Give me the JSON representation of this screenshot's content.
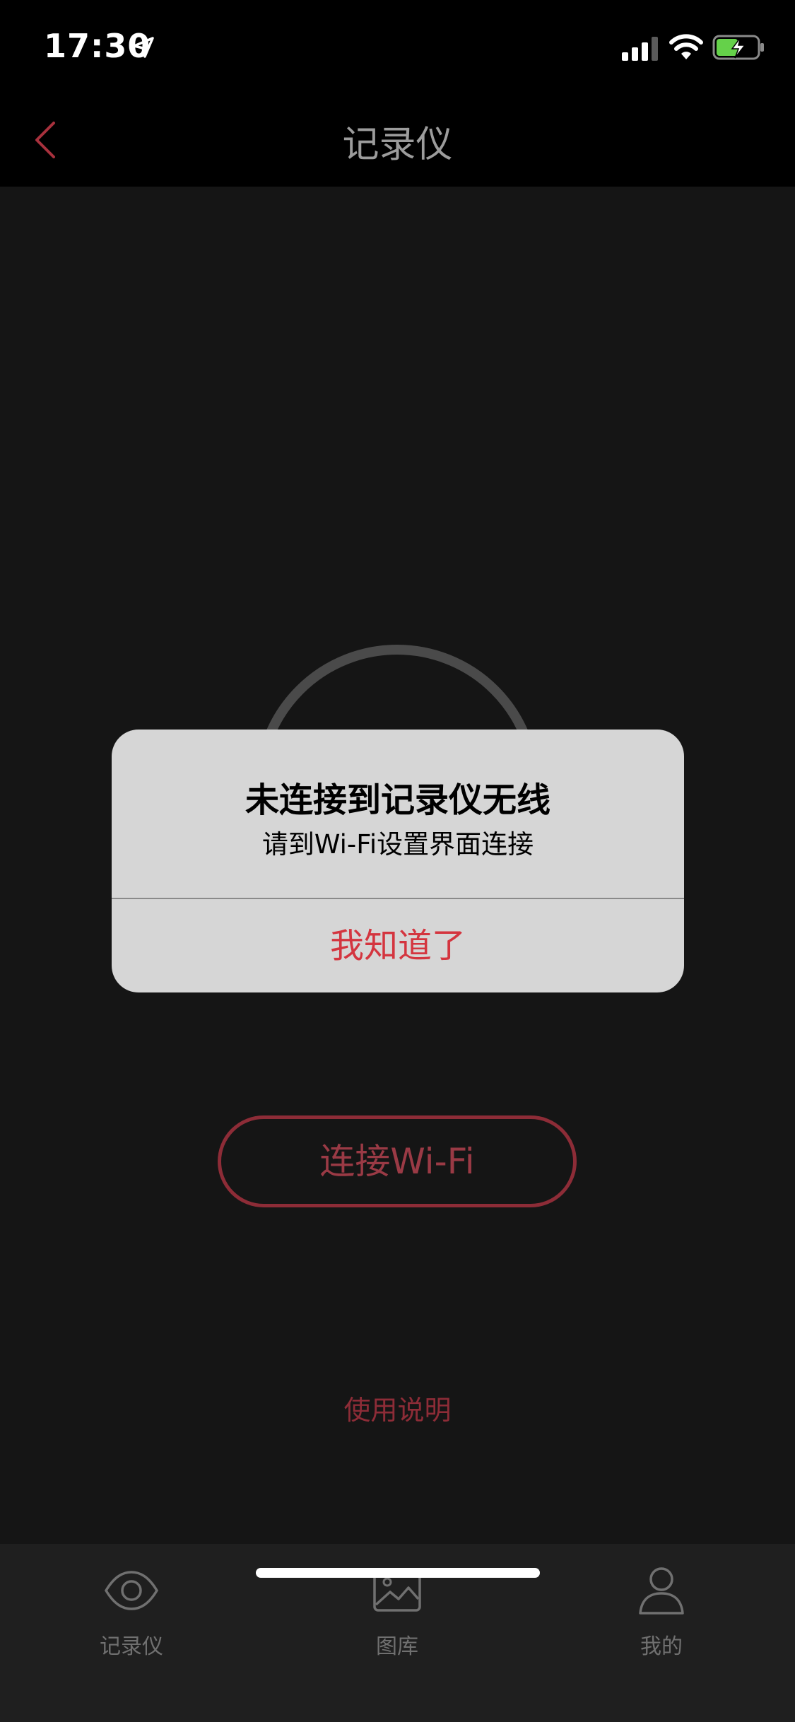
{
  "status_bar": {
    "time": "17:30"
  },
  "navbar": {
    "title": "记录仪"
  },
  "main": {
    "connect_button_label": "连接Wi-Fi",
    "manual_link_label": "使用说明"
  },
  "alert": {
    "title": "未连接到记录仪无线",
    "message": "请到Wi-Fi设置界面连接",
    "button_label": "我知道了"
  },
  "tabbar": {
    "items": [
      {
        "label": "记录仪",
        "icon": "eye-icon"
      },
      {
        "label": "图库",
        "icon": "image-icon"
      },
      {
        "label": "我的",
        "icon": "person-icon"
      }
    ]
  },
  "colors": {
    "accent": "#8d2c37",
    "alert_button": "#d4353f",
    "background": "#151515",
    "bar_background": "#000000",
    "tab_background": "#1f1f1f",
    "alert_background": "#d6d6d6"
  }
}
